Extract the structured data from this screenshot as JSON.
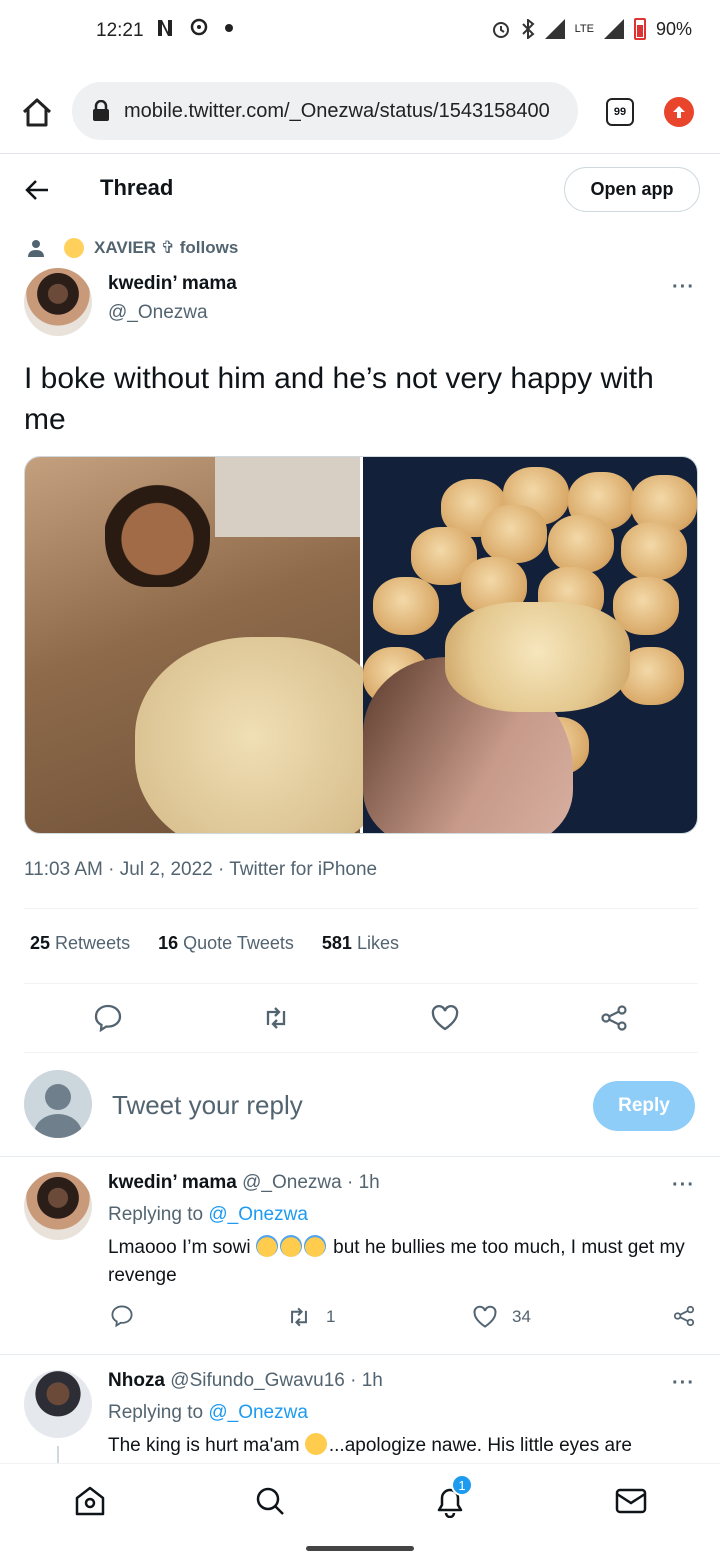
{
  "status_bar": {
    "time": "12:21",
    "battery": "90%",
    "network": "LTE"
  },
  "browser": {
    "url": "mobile.twitter.com/_Onezwa/status/1543158400",
    "tab_count": "99",
    "accent_color": "#e8452c"
  },
  "header": {
    "title": "Thread",
    "open_app_label": "Open app"
  },
  "social_context": {
    "text": "XAVIER ✞ follows"
  },
  "main_tweet": {
    "name": "kwedin’ mama",
    "handle": "@_Onezwa",
    "more": "···",
    "text": "I boke without him and he’s not very happy with me",
    "meta": "11:03 AM · Jul 2, 2022 · Twitter for iPhone",
    "stats": {
      "retweets_count": "25",
      "retweets_label": "Retweets",
      "quotes_count": "16",
      "quotes_label": "Quote Tweets",
      "likes_count": "581",
      "likes_label": "Likes"
    }
  },
  "composer": {
    "placeholder": "Tweet your reply",
    "reply_label": "Reply"
  },
  "replies": [
    {
      "name": "kwedin’ mama",
      "handle_time": "@_Onezwa · 1h",
      "replying_prefix": "Replying to",
      "replying_to": "@_Onezwa",
      "text_before": "Lmaooo I’m sowi",
      "text_after": "but he bullies me too much, I must get my revenge",
      "retweets": "1",
      "likes": "34"
    },
    {
      "name": "Nhoza",
      "handle_time": "@Sifundo_Gwavu16 · 1h",
      "replying_prefix": "Replying to",
      "replying_to": "@_Onezwa",
      "text_before": "The king is hurt ma'am",
      "text_after": "...apologize nawe. His little eyes are"
    }
  ],
  "bottom_nav": {
    "notifications_badge": "1"
  },
  "colors": {
    "twitter_blue": "#1d9bf0",
    "reply_button_disabled": "#8ecdf8"
  }
}
